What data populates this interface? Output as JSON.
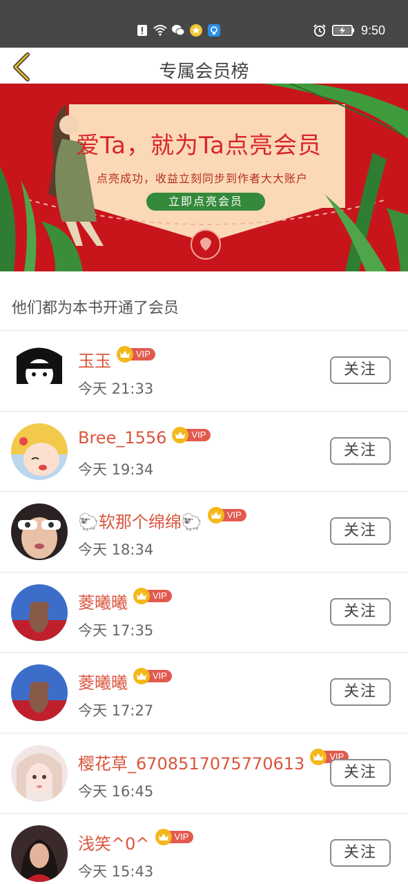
{
  "status_bar": {
    "time": "9:50",
    "left_icons": [
      "alert-icon",
      "wifi-icon",
      "wechat-icon",
      "star-icon",
      "bulb-icon"
    ],
    "right_icons": [
      "alarm-icon",
      "battery-charging-icon"
    ]
  },
  "header": {
    "title": "专属会员榜",
    "back_icon": "chevron-left-icon"
  },
  "banner": {
    "headline": "爱Ta，就为Ta点亮会员",
    "subtitle": "点亮成功，收益立刻同步到作者大大账户",
    "button_label": "立即点亮会员"
  },
  "section": {
    "heading": "他们都为本书开通了会员"
  },
  "members": [
    {
      "name": "玉玉",
      "badge": "VIP",
      "time": "今天 21:33",
      "follow_label": "关注"
    },
    {
      "name": "Bree_1556",
      "badge": "VIP",
      "time": "今天 19:34",
      "follow_label": "关注"
    },
    {
      "name": "🐑软那个绵绵🐑",
      "badge": "VIP",
      "time": "今天 18:34",
      "follow_label": "关注"
    },
    {
      "name": "菱曦曦",
      "badge": "VIP",
      "time": "今天 17:35",
      "follow_label": "关注"
    },
    {
      "name": "菱曦曦",
      "badge": "VIP",
      "time": "今天 17:27",
      "follow_label": "关注"
    },
    {
      "name": "樱花草_6708517075770613",
      "badge": "VIP",
      "time": "今天 16:45",
      "follow_label": "关注"
    },
    {
      "name": "浅笑^0^",
      "badge": "VIP",
      "time": "今天 15:43",
      "follow_label": "关注"
    }
  ],
  "colors": {
    "status_bar": "#474747",
    "banner_red": "#c8151b",
    "name_orange": "#d9553c",
    "vip_gold": "#f3b81c",
    "vip_red": "#e25a4e",
    "back_gold": "#d9a520"
  }
}
